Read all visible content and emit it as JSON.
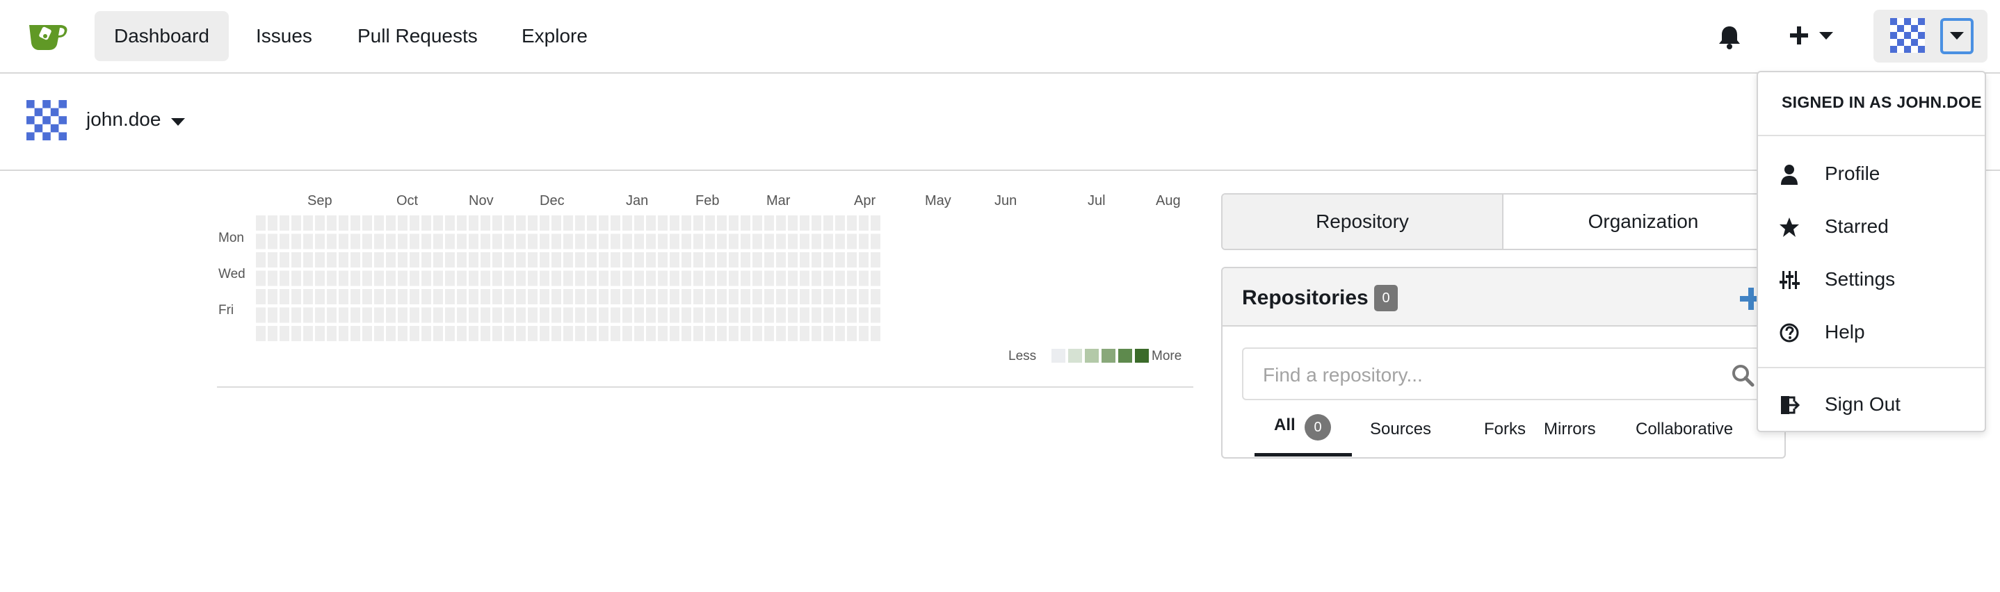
{
  "nav": {
    "items": [
      {
        "label": "Dashboard",
        "active": true
      },
      {
        "label": "Issues"
      },
      {
        "label": "Pull Requests"
      },
      {
        "label": "Explore"
      }
    ],
    "icons": {
      "logo": "gitea-logo",
      "notifications": "bell-icon",
      "create": "plus-icon",
      "user_menu": "avatar-with-caret"
    }
  },
  "context": {
    "username": "john.doe"
  },
  "heatmap": {
    "months": [
      "Sep",
      "Oct",
      "Nov",
      "Dec",
      "Jan",
      "Feb",
      "Mar",
      "Apr",
      "May",
      "Jun",
      "Jul",
      "Aug"
    ],
    "days": [
      "Mon",
      "Wed",
      "Fri"
    ],
    "legend_less": "Less",
    "legend_more": "More",
    "legend_colors": [
      "#ebedf0",
      "#d6e2d3",
      "#b3c9a8",
      "#89a87a",
      "#5e8a4d",
      "#3b6b2a"
    ],
    "empty_cell_color": "#ededed"
  },
  "repo_panel": {
    "tabs": [
      {
        "label": "Repository",
        "active": true
      },
      {
        "label": "Organization"
      }
    ],
    "title": "Repositories",
    "count": "0",
    "search_placeholder": "Find a repository...",
    "filters": [
      {
        "label": "All",
        "count": "0",
        "active": true
      },
      {
        "label": "Sources"
      },
      {
        "label": "Forks"
      },
      {
        "label": "Mirrors"
      },
      {
        "label": "Collaborative"
      }
    ],
    "accent": "#4183c4"
  },
  "user_menu": {
    "header": "SIGNED IN AS JOHN.DOE",
    "items": [
      {
        "label": "Profile",
        "icon": "person-icon"
      },
      {
        "label": "Starred",
        "icon": "star-icon"
      },
      {
        "label": "Settings",
        "icon": "sliders-icon"
      },
      {
        "label": "Help",
        "icon": "question-icon"
      }
    ],
    "signout": {
      "label": "Sign Out",
      "icon": "sign-out-icon"
    }
  }
}
